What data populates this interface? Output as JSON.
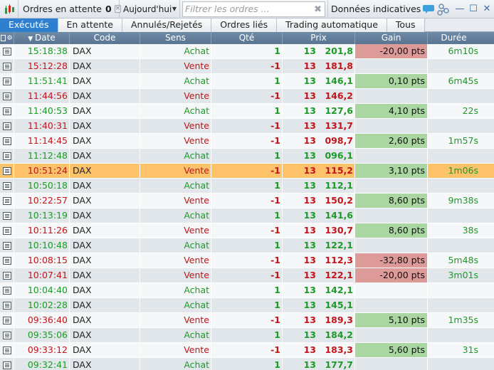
{
  "toolbar": {
    "pending_label": "Ordres en attente",
    "pending_count": "0",
    "pending_close": "×",
    "date_filter": "Aujourd'hui",
    "filter_placeholder": "Filtrer les ordres ...",
    "filter_clear": "✖",
    "info_label": "Données indicatives"
  },
  "window": {
    "minimize": "—",
    "maximize": "☐",
    "close": "✕"
  },
  "tabs": [
    "Exécutés",
    "En attente",
    "Annulés/Rejetés",
    "Ordres liés",
    "Trading automatique",
    "Tous"
  ],
  "active_tab": "Exécutés",
  "columns": {
    "date": "Date",
    "code": "Code",
    "sens": "Sens",
    "qty": "Qté",
    "prix": "Prix",
    "gain": "Gain",
    "duree": "Durée"
  },
  "colors": {
    "buy": "#1c9a28",
    "sell": "#c0151b",
    "gain_positive": "#a9d6a1",
    "gain_negative": "#dc9a98",
    "selected_row": "#ffc36b",
    "active_tab": "#2f7fd0"
  },
  "orders": [
    {
      "time": "15:18:38",
      "code": "DAX",
      "sens": "Achat",
      "qty": "1",
      "prix_int": "13",
      "prix_frac": "201,8",
      "gain": "-20,00 pts",
      "gain_sign": "neg",
      "duree": "6m10s"
    },
    {
      "time": "15:12:28",
      "code": "DAX",
      "sens": "Vente",
      "qty": "-1",
      "prix_int": "13",
      "prix_frac": "181,8",
      "gain": "",
      "gain_sign": "",
      "duree": ""
    },
    {
      "time": "11:51:41",
      "code": "DAX",
      "sens": "Achat",
      "qty": "1",
      "prix_int": "13",
      "prix_frac": "146,1",
      "gain": "0,10 pts",
      "gain_sign": "pos",
      "duree": "6m45s"
    },
    {
      "time": "11:44:56",
      "code": "DAX",
      "sens": "Vente",
      "qty": "-1",
      "prix_int": "13",
      "prix_frac": "146,2",
      "gain": "",
      "gain_sign": "",
      "duree": ""
    },
    {
      "time": "11:40:53",
      "code": "DAX",
      "sens": "Achat",
      "qty": "1",
      "prix_int": "13",
      "prix_frac": "127,6",
      "gain": "4,10 pts",
      "gain_sign": "pos",
      "duree": "22s"
    },
    {
      "time": "11:40:31",
      "code": "DAX",
      "sens": "Vente",
      "qty": "-1",
      "prix_int": "13",
      "prix_frac": "131,7",
      "gain": "",
      "gain_sign": "",
      "duree": ""
    },
    {
      "time": "11:14:45",
      "code": "DAX",
      "sens": "Vente",
      "qty": "-1",
      "prix_int": "13",
      "prix_frac": "098,7",
      "gain": "2,60 pts",
      "gain_sign": "pos",
      "duree": "1m57s"
    },
    {
      "time": "11:12:48",
      "code": "DAX",
      "sens": "Achat",
      "qty": "1",
      "prix_int": "13",
      "prix_frac": "096,1",
      "gain": "",
      "gain_sign": "",
      "duree": ""
    },
    {
      "time": "10:51:24",
      "code": "DAX",
      "sens": "Vente",
      "qty": "-1",
      "prix_int": "13",
      "prix_frac": "115,2",
      "gain": "3,10 pts",
      "gain_sign": "pos",
      "duree": "1m06s",
      "selected": true
    },
    {
      "time": "10:50:18",
      "code": "DAX",
      "sens": "Achat",
      "qty": "1",
      "prix_int": "13",
      "prix_frac": "112,1",
      "gain": "",
      "gain_sign": "",
      "duree": ""
    },
    {
      "time": "10:22:57",
      "code": "DAX",
      "sens": "Vente",
      "qty": "-1",
      "prix_int": "13",
      "prix_frac": "150,2",
      "gain": "8,60 pts",
      "gain_sign": "pos",
      "duree": "9m38s"
    },
    {
      "time": "10:13:19",
      "code": "DAX",
      "sens": "Achat",
      "qty": "1",
      "prix_int": "13",
      "prix_frac": "141,6",
      "gain": "",
      "gain_sign": "",
      "duree": ""
    },
    {
      "time": "10:11:26",
      "code": "DAX",
      "sens": "Vente",
      "qty": "-1",
      "prix_int": "13",
      "prix_frac": "130,7",
      "gain": "8,60 pts",
      "gain_sign": "pos",
      "duree": "38s"
    },
    {
      "time": "10:10:48",
      "code": "DAX",
      "sens": "Achat",
      "qty": "1",
      "prix_int": "13",
      "prix_frac": "122,1",
      "gain": "",
      "gain_sign": "",
      "duree": ""
    },
    {
      "time": "10:08:15",
      "code": "DAX",
      "sens": "Vente",
      "qty": "-1",
      "prix_int": "13",
      "prix_frac": "112,3",
      "gain": "-32,80 pts",
      "gain_sign": "neg",
      "duree": "5m48s"
    },
    {
      "time": "10:07:41",
      "code": "DAX",
      "sens": "Vente",
      "qty": "-1",
      "prix_int": "13",
      "prix_frac": "122,1",
      "gain": "-20,00 pts",
      "gain_sign": "neg",
      "duree": "3m01s"
    },
    {
      "time": "10:04:40",
      "code": "DAX",
      "sens": "Achat",
      "qty": "1",
      "prix_int": "13",
      "prix_frac": "142,1",
      "gain": "",
      "gain_sign": "",
      "duree": ""
    },
    {
      "time": "10:02:28",
      "code": "DAX",
      "sens": "Achat",
      "qty": "1",
      "prix_int": "13",
      "prix_frac": "145,1",
      "gain": "",
      "gain_sign": "",
      "duree": ""
    },
    {
      "time": "09:36:40",
      "code": "DAX",
      "sens": "Vente",
      "qty": "-1",
      "prix_int": "13",
      "prix_frac": "189,3",
      "gain": "5,10 pts",
      "gain_sign": "pos",
      "duree": "1m35s"
    },
    {
      "time": "09:35:06",
      "code": "DAX",
      "sens": "Achat",
      "qty": "1",
      "prix_int": "13",
      "prix_frac": "184,2",
      "gain": "",
      "gain_sign": "",
      "duree": ""
    },
    {
      "time": "09:33:12",
      "code": "DAX",
      "sens": "Vente",
      "qty": "-1",
      "prix_int": "13",
      "prix_frac": "183,3",
      "gain": "5,60 pts",
      "gain_sign": "pos",
      "duree": "31s"
    },
    {
      "time": "09:32:41",
      "code": "DAX",
      "sens": "Achat",
      "qty": "1",
      "prix_int": "13",
      "prix_frac": "177,7",
      "gain": "",
      "gain_sign": "",
      "duree": ""
    }
  ]
}
